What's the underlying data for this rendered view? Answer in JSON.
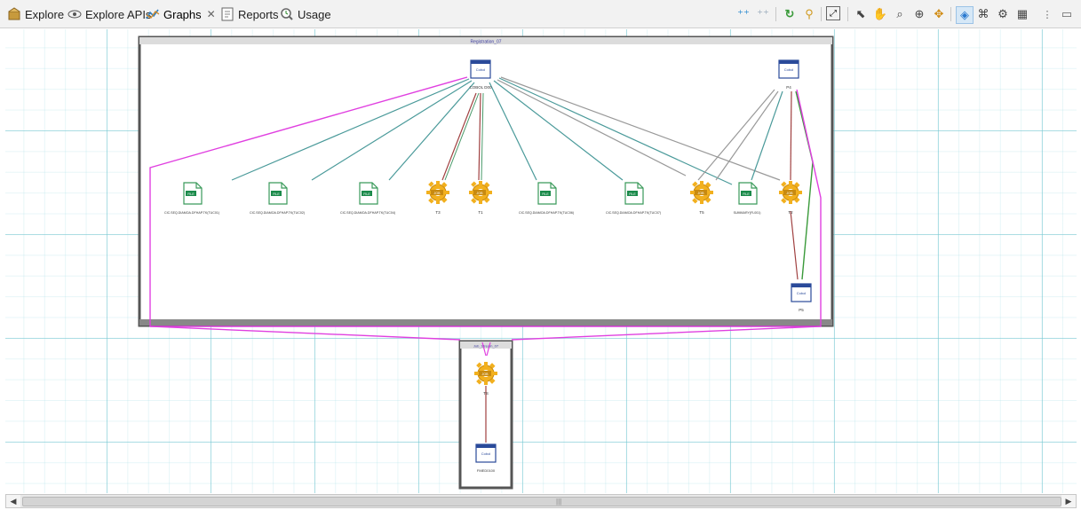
{
  "tabs": [
    {
      "label": "Explore",
      "icon": "explore-icon"
    },
    {
      "label": "Explore APIs",
      "icon": "explore-apis-icon"
    },
    {
      "label": "Graphs",
      "icon": "graphs-icon",
      "active": true
    },
    {
      "label": "Reports",
      "icon": "reports-icon"
    },
    {
      "label": "Usage",
      "icon": "usage-icon"
    }
  ],
  "toolbar": {
    "icons": [
      "expand-icon",
      "collapse-icon",
      "refresh-icon",
      "layout-icon",
      "zoom-fit-icon",
      "select-icon",
      "pan-icon",
      "zoom-in-icon",
      "zoom-out-icon",
      "center-icon",
      "filter-icon",
      "link-icon",
      "settings-icon",
      "grid-icon",
      "more-icon",
      "minimize-icon"
    ]
  },
  "graph": {
    "main_container": {
      "title": "Registration_07"
    },
    "small_container": {
      "title": "Job_Stream_07"
    },
    "nodes": {
      "cobol_top": {
        "kind": "program",
        "label": "COBOL D00",
        "caption": "Cobol"
      },
      "p4": {
        "kind": "program",
        "label": "P4",
        "caption": "Cobol"
      },
      "p5": {
        "kind": "program",
        "label": "P5",
        "caption": "Cobol"
      },
      "file1": {
        "kind": "file",
        "label": "CIC.SEQ.DIAMOA.DFHAP.TK(TUC01)"
      },
      "file2": {
        "kind": "file",
        "label": "CIC.SEQ.DIAMOA.DFHAP.TK(TUC02)"
      },
      "file3": {
        "kind": "file",
        "label": "CIC.SEQ.DIAMOA.DFHAP.TK(TUC04)"
      },
      "t3": {
        "kind": "job",
        "label": "T3"
      },
      "t1": {
        "kind": "job",
        "label": "T1"
      },
      "file4": {
        "kind": "file",
        "label": "CIC.SEQ.DIAMOA.DFHAP.TK(TUC06)"
      },
      "file5": {
        "kind": "file",
        "label": "CIC.SEQ.DIAMOA.DFHAP.TK(TUC07)"
      },
      "t5": {
        "kind": "job",
        "label": "T5"
      },
      "summary": {
        "kind": "file",
        "label": "SUMMARY(FL001)"
      },
      "t2": {
        "kind": "job",
        "label": "T2"
      },
      "ts": {
        "kind": "job",
        "label": "TS"
      },
      "fmed": {
        "kind": "program",
        "label": "FMED0100",
        "caption": "Cobol"
      }
    },
    "badge_file": "FILE",
    "badge_job": "JOB"
  },
  "scrollbar": {
    "grip": "|||"
  }
}
